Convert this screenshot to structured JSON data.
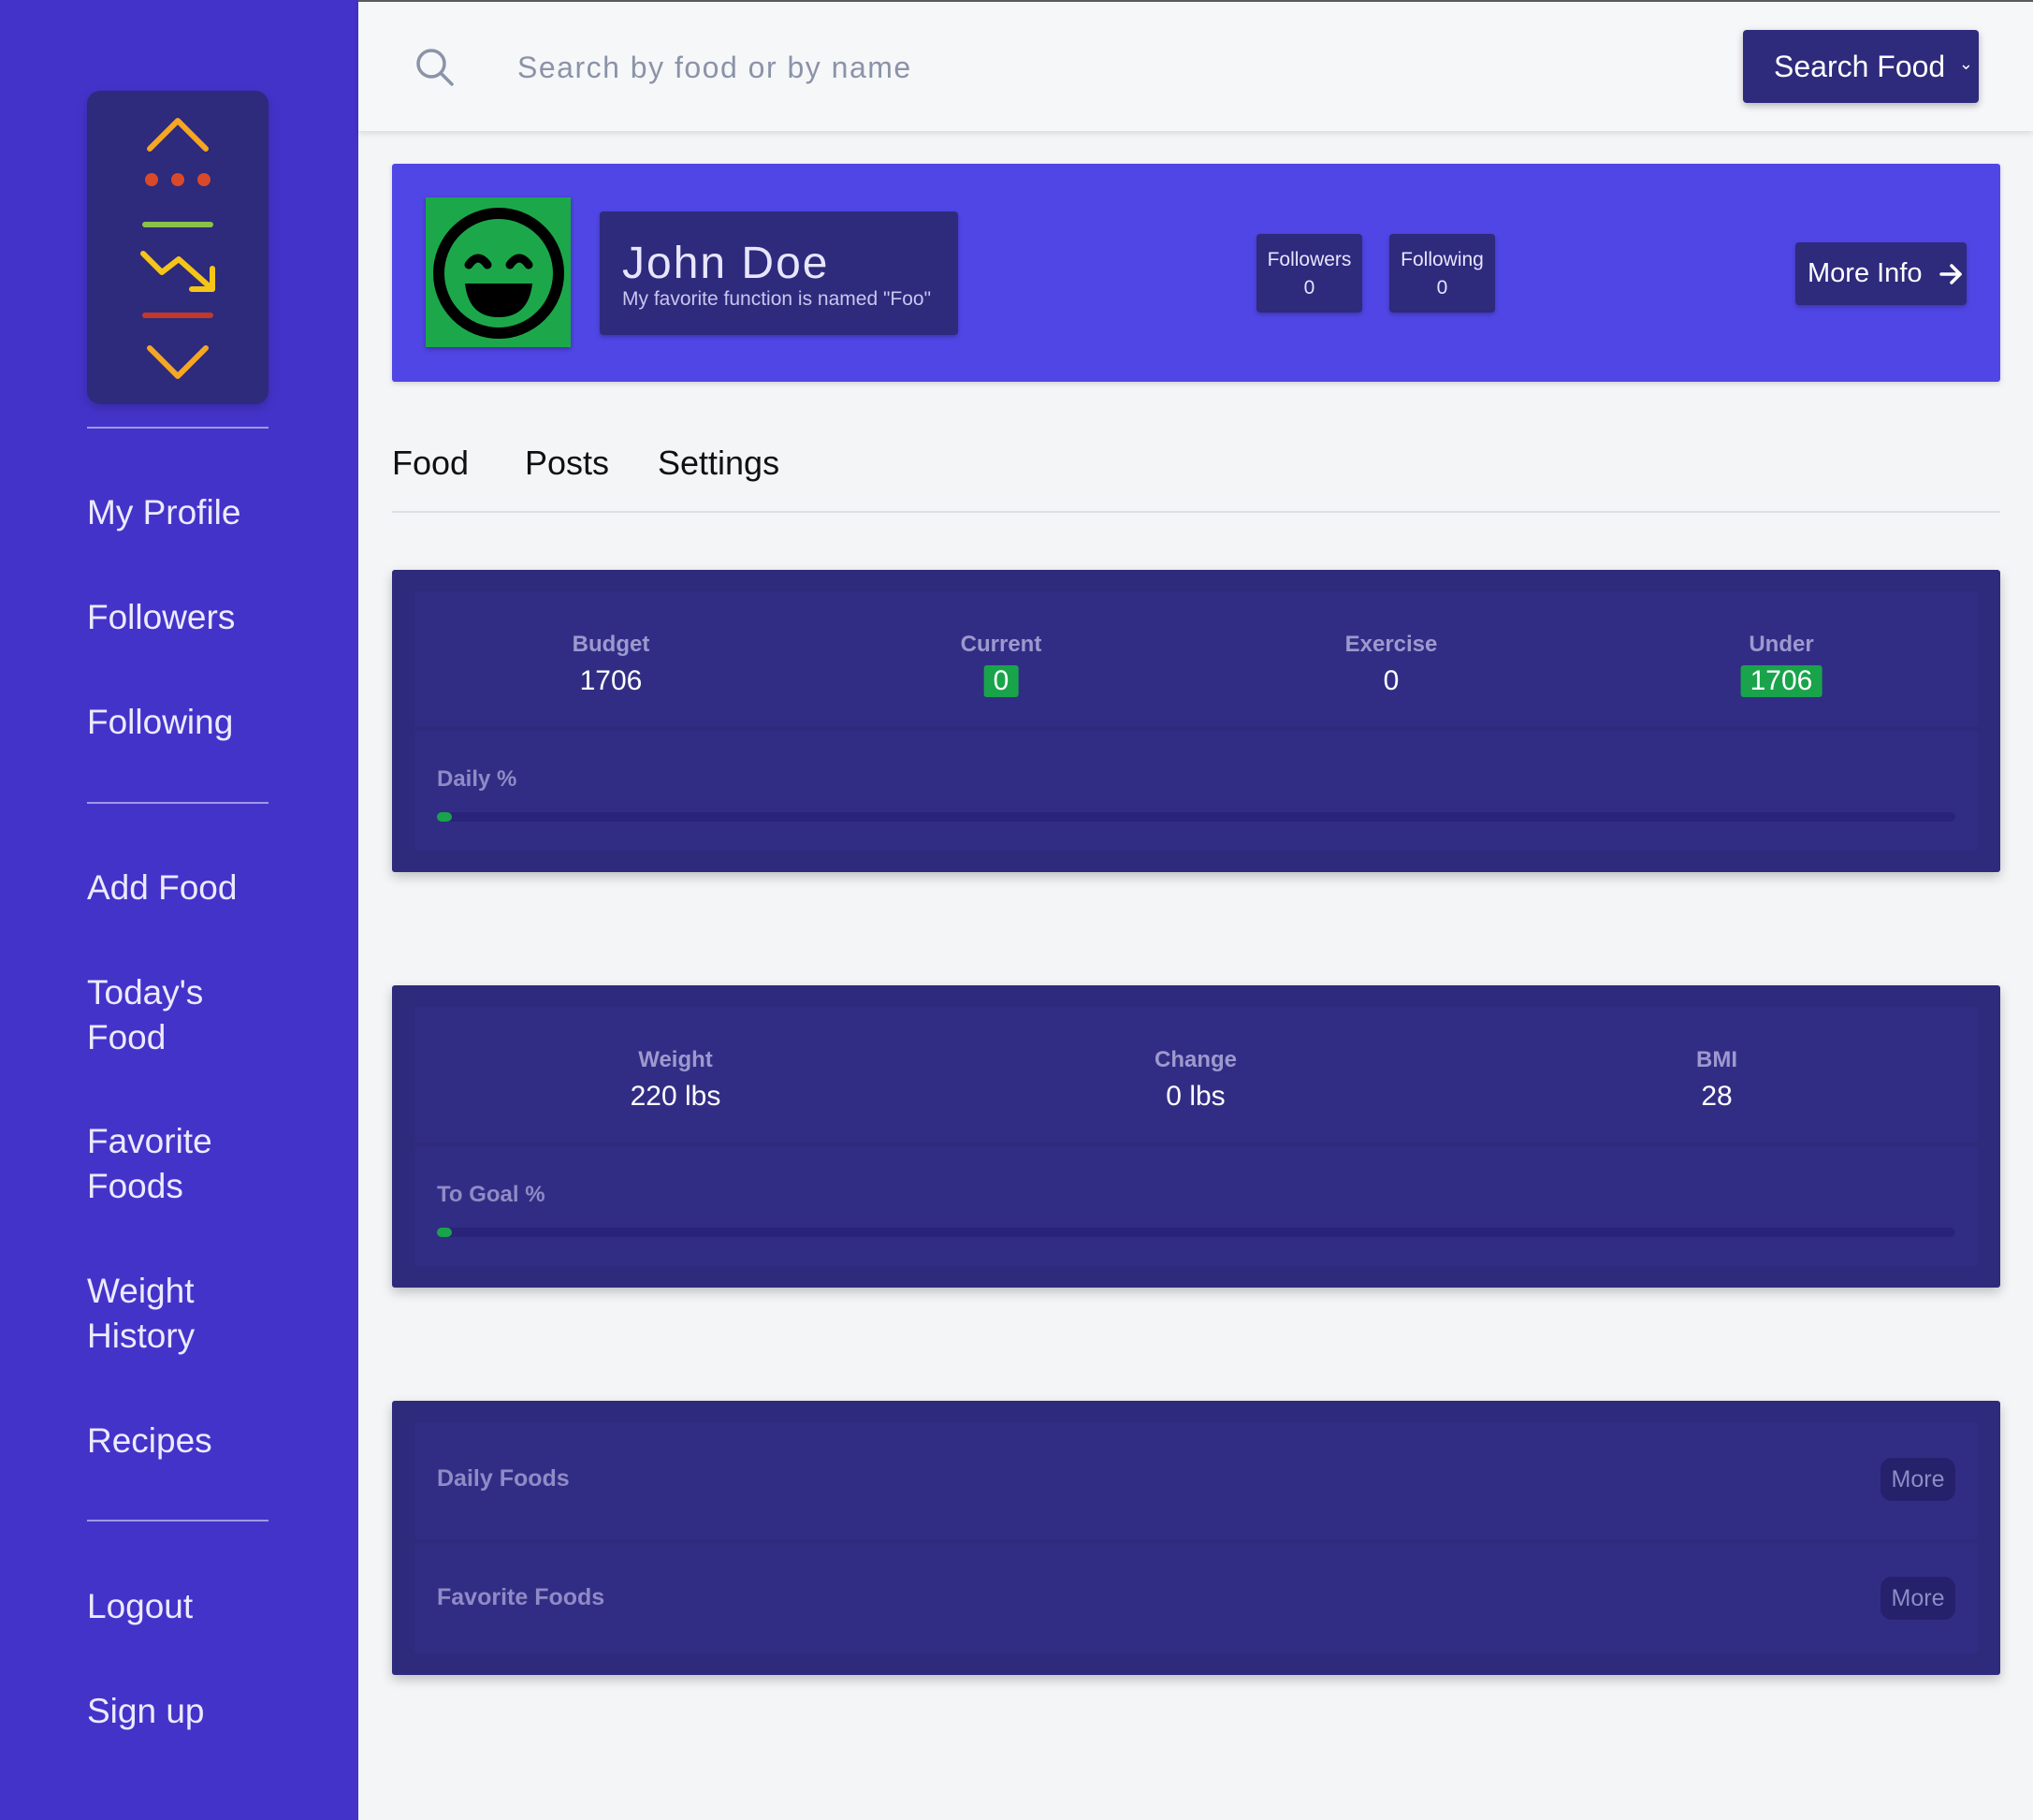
{
  "sidebar": {
    "groups": [
      [
        "My Profile",
        "Followers",
        "Following"
      ],
      [
        "Add Food",
        "Today's Food",
        "Favorite Foods",
        "Weight History",
        "Recipes"
      ],
      [
        "Logout",
        "Sign up"
      ]
    ],
    "items": {
      "my_profile": "My Profile",
      "followers": "Followers",
      "following": "Following",
      "add_food": "Add Food",
      "todays_food_1": "Today's",
      "todays_food_2": "Food",
      "favorite_foods_1": "Favorite",
      "favorite_foods_2": "Foods",
      "weight_history_1": "Weight",
      "weight_history_2": "History",
      "recipes": "Recipes",
      "logout": "Logout",
      "sign_up": "Sign up"
    }
  },
  "search": {
    "placeholder": "Search by food or by name",
    "button_label": "Search Food"
  },
  "profile": {
    "name": "John Doe",
    "bio": "My favorite function is named \"Foo\"",
    "followers_label": "Followers",
    "followers_count": "0",
    "following_label": "Following",
    "following_count": "0",
    "more_info_label": "More Info"
  },
  "tabs": [
    "Food",
    "Posts",
    "Settings"
  ],
  "tab_labels": {
    "food": "Food",
    "posts": "Posts",
    "settings": "Settings"
  },
  "calories": {
    "budget_label": "Budget",
    "budget": "1706",
    "current_label": "Current",
    "current": "0",
    "exercise_label": "Exercise",
    "exercise": "0",
    "under_label": "Under",
    "under": "1706",
    "daily_label": "Daily %",
    "daily_progress_pct": 0
  },
  "weight": {
    "weight_label": "Weight",
    "weight": "220 lbs",
    "change_label": "Change",
    "change": "0 lbs",
    "bmi_label": "BMI",
    "bmi": "28",
    "goal_label": "To Goal %",
    "goal_progress_pct": 0
  },
  "foods": {
    "daily_label": "Daily Foods",
    "favorite_label": "Favorite Foods",
    "more_label": "More"
  },
  "colors": {
    "sidebar_bg": "#4433c9",
    "navy": "#2e2a7c",
    "banner": "#5046e5",
    "green": "#19a44b"
  }
}
